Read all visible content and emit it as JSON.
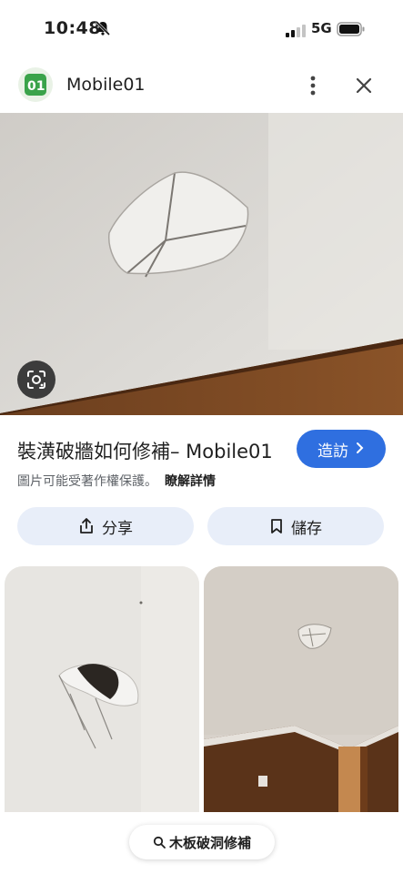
{
  "status": {
    "time": "10:48",
    "network": "5G"
  },
  "header": {
    "site_name": "Mobile01"
  },
  "result": {
    "title": "裝潢破牆如何修補– Mobile01",
    "visit_label": "造訪",
    "copyright_text": "圖片可能受著作權保護。",
    "learn_more": "瞭解詳情"
  },
  "actions": {
    "share_label": "分享",
    "save_label": "儲存"
  },
  "search_chip": {
    "label": "木板破洞修補"
  },
  "icons": {
    "logo": "mobile01-logo-icon",
    "more": "more-vert-icon",
    "close": "close-icon",
    "lens": "lens-icon",
    "share": "share-icon",
    "save": "bookmark-icon",
    "search": "search-icon"
  },
  "colors": {
    "accent": "#2f6fe0",
    "chip_bg": "#e8eef9",
    "logo_green": "#3aa34a"
  }
}
